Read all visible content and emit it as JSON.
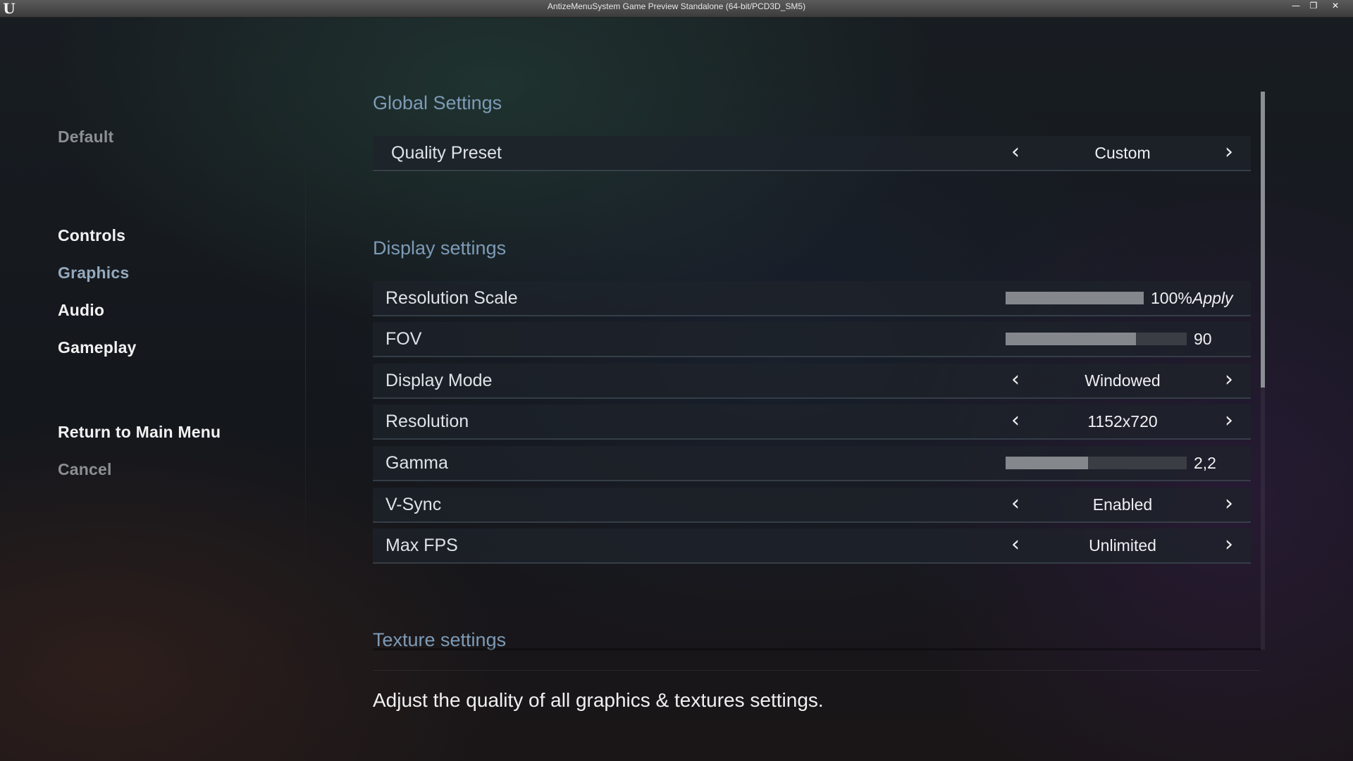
{
  "window": {
    "title": "AntizeMenuSystem Game Preview Standalone (64-bit/PCD3D_SM5)",
    "logo": "U",
    "controls": {
      "minimize": "—",
      "restore": "❐",
      "close": "✕"
    }
  },
  "sidebar": {
    "preset_label": "Default",
    "items": [
      {
        "label": "Controls"
      },
      {
        "label": "Graphics"
      },
      {
        "label": "Audio"
      },
      {
        "label": "Gameplay"
      }
    ],
    "return_label": "Return to Main Menu",
    "cancel_label": "Cancel"
  },
  "global": {
    "title": "Global Settings",
    "quality_preset": {
      "label": "Quality Preset",
      "value": "Custom"
    }
  },
  "display": {
    "title": "Display settings",
    "resolution_scale": {
      "label": "Resolution Scale",
      "value": "100%",
      "fraction": 1.0,
      "apply_label": "Apply"
    },
    "fov": {
      "label": "FOV",
      "value": "90",
      "fraction": 0.72
    },
    "display_mode": {
      "label": "Display Mode",
      "value": "Windowed"
    },
    "resolution": {
      "label": "Resolution",
      "value": "1152x720"
    },
    "gamma": {
      "label": "Gamma",
      "value": "2,2",
      "fraction": 0.455
    },
    "vsync": {
      "label": "V-Sync",
      "value": "Enabled"
    },
    "max_fps": {
      "label": "Max FPS",
      "value": "Unlimited"
    }
  },
  "texture": {
    "title": "Texture settings"
  },
  "description": "Adjust the quality of all graphics & textures settings.",
  "icons": {
    "arrow_left": "‹",
    "arrow_right": "›"
  },
  "scroll": {
    "fraction_visible": 0.53
  },
  "colors": {
    "section_title": "#7d9bb6",
    "menu_active": "#94a9bd",
    "menu_dim": "#8c8f93",
    "slider_fill": "#84888d",
    "slider_track": "#3a3e44"
  }
}
